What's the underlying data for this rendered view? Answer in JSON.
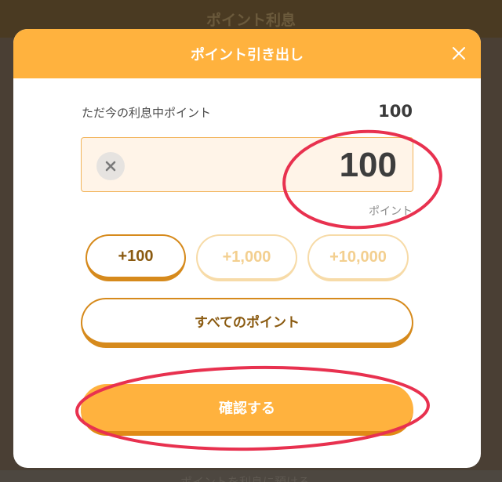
{
  "background": {
    "header_title": "ポイント利息",
    "bottom_text": "ポイントを利息に預ける"
  },
  "modal": {
    "title": "ポイント引き出し",
    "close_icon": "close-icon"
  },
  "balance": {
    "label": "ただ今の利息中ポイント",
    "value": "100"
  },
  "amount_input": {
    "value": "100",
    "unit": "ポイント",
    "clear_icon": "clear-icon"
  },
  "quick_add": [
    {
      "label": "+100",
      "state": "active"
    },
    {
      "label": "+1,000",
      "state": "inactive"
    },
    {
      "label": "+10,000",
      "state": "inactive"
    }
  ],
  "all_points_label": "すべてのポイント",
  "confirm_label": "確認する",
  "colors": {
    "accent": "#ffb23e",
    "accent_dark": "#d68a1c",
    "annotation": "#e8314f"
  }
}
